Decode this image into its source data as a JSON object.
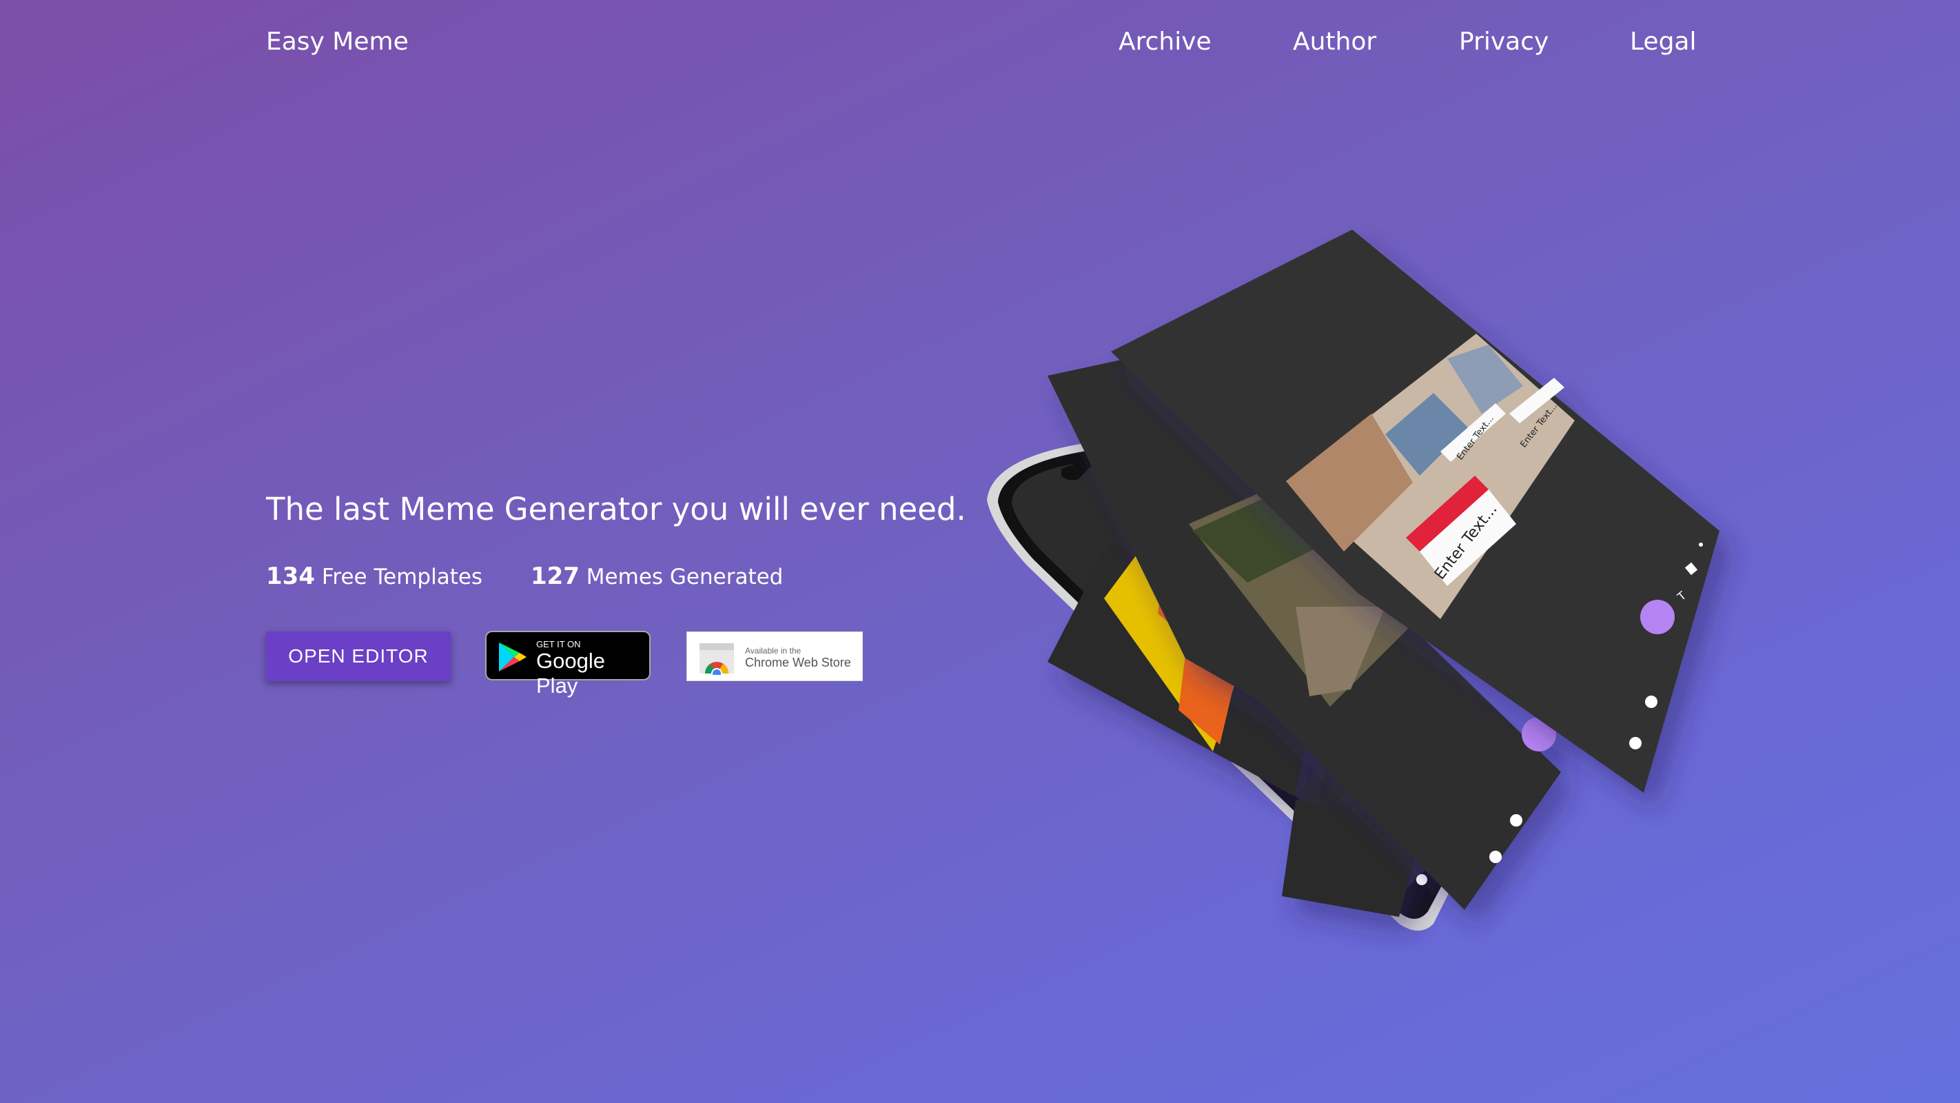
{
  "brand": "Easy Meme",
  "nav": {
    "items": [
      {
        "label": "Archive"
      },
      {
        "label": "Author"
      },
      {
        "label": "Privacy"
      },
      {
        "label": "Legal"
      }
    ]
  },
  "hero": {
    "title": "The last Meme Generator you will ever need.",
    "stats": [
      {
        "value": "134",
        "label": "Free Templates"
      },
      {
        "value": "127",
        "label": "Memes Generated"
      }
    ],
    "open_editor_label": "OPEN EDITOR",
    "google_play": {
      "small": "GET IT ON",
      "big": "Google Play"
    },
    "chrome_store": {
      "small": "Available in the",
      "big": "Chrome Web Store"
    }
  },
  "mockup": {
    "text_placeholder": "Enter Text..."
  },
  "colors": {
    "accent": "#6b3fc6",
    "fab": "#b583f2",
    "screen_dark": "#2e2e2e"
  }
}
